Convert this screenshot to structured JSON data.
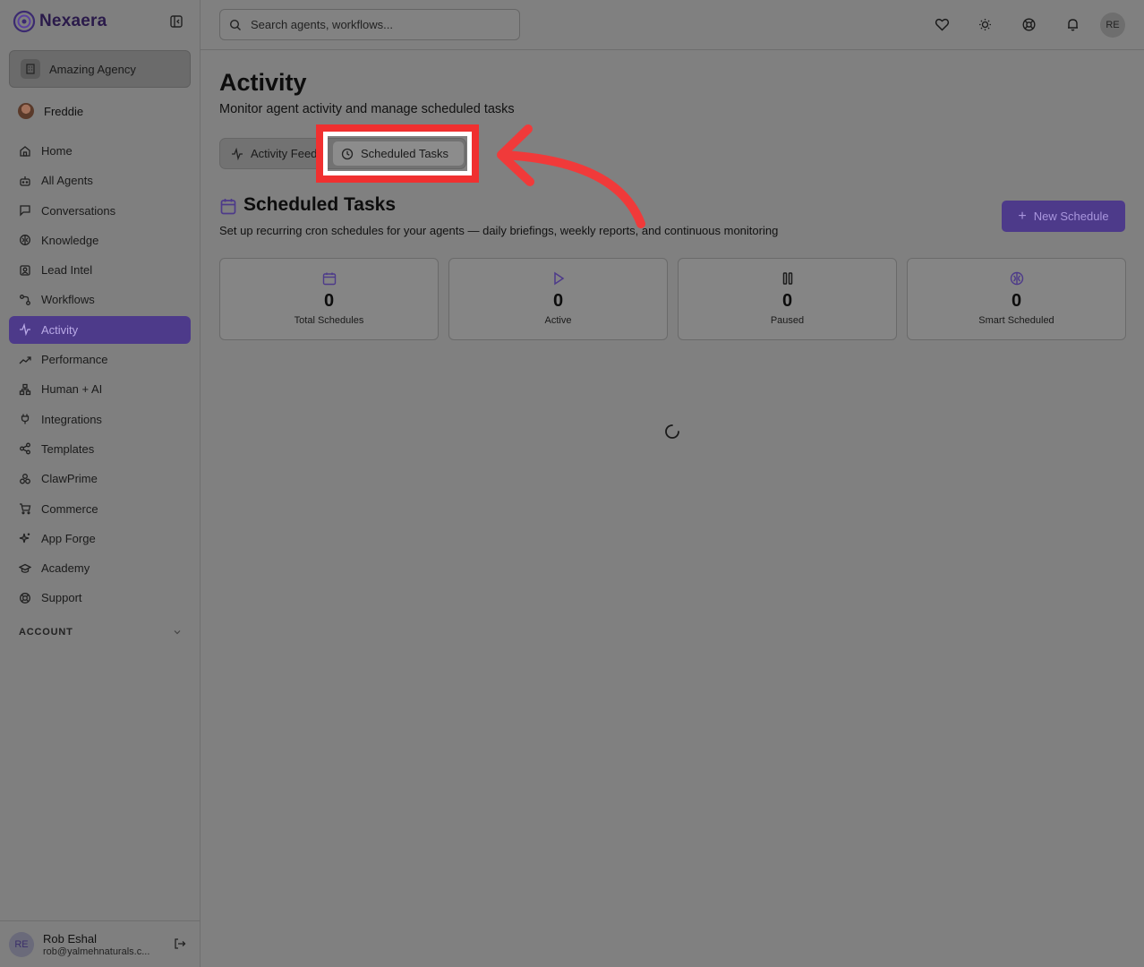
{
  "app": {
    "logo_text": "Nexaera"
  },
  "sidebar": {
    "agency": "Amazing Agency",
    "user": "Freddie",
    "items": [
      {
        "label": "Home",
        "icon": "home-icon"
      },
      {
        "label": "All Agents",
        "icon": "bot-icon"
      },
      {
        "label": "Conversations",
        "icon": "chat-icon"
      },
      {
        "label": "Knowledge",
        "icon": "brain-icon"
      },
      {
        "label": "Lead Intel",
        "icon": "contact-icon"
      },
      {
        "label": "Workflows",
        "icon": "workflow-icon"
      },
      {
        "label": "Activity",
        "icon": "activity-icon",
        "active": true
      },
      {
        "label": "Performance",
        "icon": "trend-icon"
      },
      {
        "label": "Human + AI",
        "icon": "network-icon"
      },
      {
        "label": "Integrations",
        "icon": "plug-icon"
      },
      {
        "label": "Templates",
        "icon": "share-icon"
      },
      {
        "label": "ClawPrime",
        "icon": "cluster-icon"
      },
      {
        "label": "Commerce",
        "icon": "cart-icon"
      },
      {
        "label": "App Forge",
        "icon": "sparkle-icon"
      },
      {
        "label": "Academy",
        "icon": "graduation-icon"
      },
      {
        "label": "Support",
        "icon": "lifebuoy-icon"
      }
    ],
    "account_label": "ACCOUNT",
    "footer": {
      "initials": "RE",
      "name": "Rob Eshal",
      "email": "rob@yalmehnaturals.c..."
    }
  },
  "topbar": {
    "search_placeholder": "Search agents, workflows...",
    "avatar_initials": "RE"
  },
  "main": {
    "title": "Activity",
    "subtitle": "Monitor agent activity and manage scheduled tasks",
    "tabs": [
      {
        "label": "Activity Feed"
      },
      {
        "label": "Scheduled Tasks",
        "selected": true
      }
    ],
    "section": {
      "title": "Scheduled Tasks",
      "subtitle": "Set up recurring cron schedules for your agents — daily briefings, weekly reports, and continuous monitoring",
      "new_button": "New Schedule"
    },
    "stats": [
      {
        "value": "0",
        "label": "Total Schedules",
        "icon": "calendar-icon"
      },
      {
        "value": "0",
        "label": "Active",
        "icon": "play-icon"
      },
      {
        "value": "0",
        "label": "Paused",
        "icon": "pause-icon"
      },
      {
        "value": "0",
        "label": "Smart Scheduled",
        "icon": "brain-icon"
      }
    ]
  },
  "colors": {
    "accent": "#4d3a8a",
    "accent_text": "#b9a9e6",
    "highlight": "#f03030"
  }
}
